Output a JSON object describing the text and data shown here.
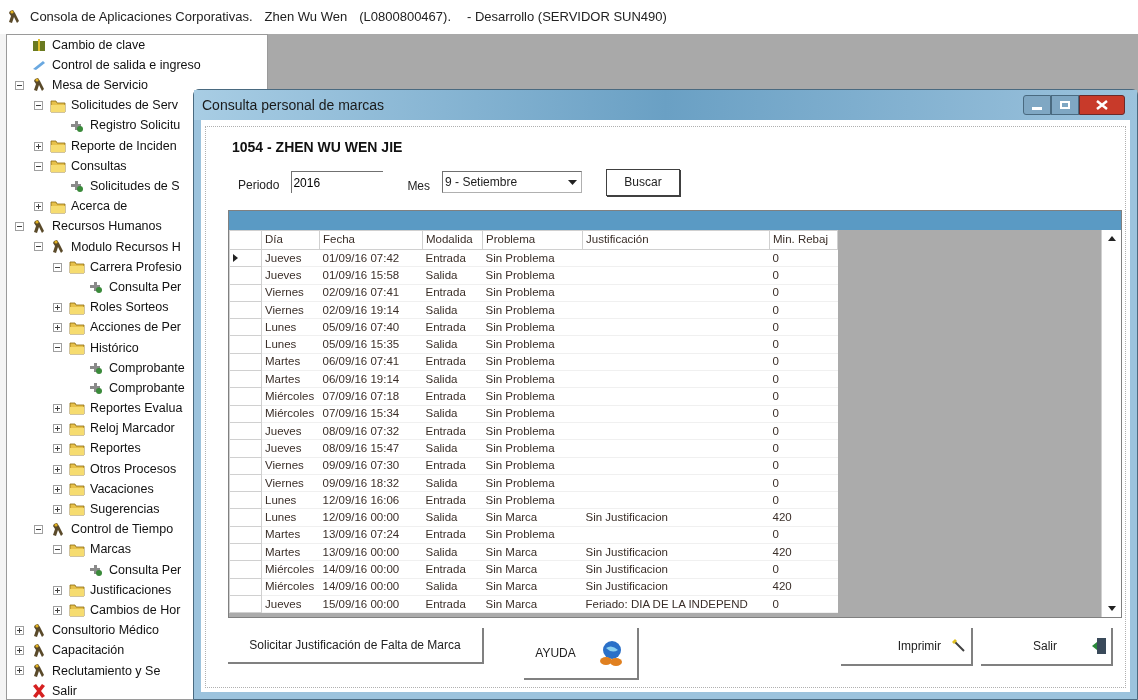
{
  "app_title": {
    "title": "Consola de Aplicaciones Corporativas.",
    "user": "Zhen Wu Wen",
    "code": "(L0800800467).",
    "environment": "- Desarrollo (SERVIDOR SUN490)"
  },
  "tree": [
    {
      "label": "Cambio de clave",
      "kind": "package"
    },
    {
      "label": "Control de salida e ingreso",
      "kind": "pen"
    },
    {
      "label": "Mesa de Servicio",
      "kind": "app",
      "expanded": true,
      "children": [
        {
          "label": "Solicitudes de Serv",
          "kind": "folder",
          "expanded": true,
          "children": [
            {
              "label": "Registro Solicitu",
              "kind": "form"
            }
          ]
        },
        {
          "label": "Reporte de Inciden",
          "kind": "folder",
          "expanded": false
        },
        {
          "label": "Consultas",
          "kind": "folder",
          "expanded": true,
          "children": [
            {
              "label": "Solicitudes de S",
              "kind": "form"
            }
          ]
        },
        {
          "label": "Acerca de",
          "kind": "folder",
          "expanded": false
        }
      ]
    },
    {
      "label": "Recursos Humanos",
      "kind": "app",
      "expanded": true,
      "children": [
        {
          "label": "Modulo Recursos H",
          "kind": "app",
          "expanded": true,
          "children": [
            {
              "label": "Carrera Profesio",
              "kind": "folder",
              "expanded": true,
              "children": [
                {
                  "label": "Consulta Per",
                  "kind": "form"
                }
              ]
            },
            {
              "label": "Roles Sorteos",
              "kind": "folder",
              "expanded": false
            },
            {
              "label": "Acciones de Per",
              "kind": "folder",
              "expanded": false
            },
            {
              "label": "Histórico",
              "kind": "folder",
              "expanded": true,
              "children": [
                {
                  "label": "Comprobante",
                  "kind": "form"
                },
                {
                  "label": "Comprobante",
                  "kind": "form"
                }
              ]
            },
            {
              "label": "Reportes Evalua",
              "kind": "folder",
              "expanded": false
            },
            {
              "label": "Reloj Marcador",
              "kind": "folder",
              "expanded": false
            },
            {
              "label": "Reportes",
              "kind": "folder",
              "expanded": false
            },
            {
              "label": "Otros Procesos",
              "kind": "folder",
              "expanded": false
            },
            {
              "label": "Vacaciones",
              "kind": "folder",
              "expanded": false
            },
            {
              "label": "Sugerencias",
              "kind": "folder",
              "expanded": false
            }
          ]
        },
        {
          "label": "Control de Tiempo",
          "kind": "app",
          "expanded": true,
          "children": [
            {
              "label": "Marcas",
              "kind": "folder",
              "expanded": true,
              "children": [
                {
                  "label": "Consulta Per",
                  "kind": "form"
                }
              ]
            },
            {
              "label": "Justificaciones",
              "kind": "folder",
              "expanded": false
            },
            {
              "label": "Cambios de Hor",
              "kind": "folder",
              "expanded": false
            }
          ]
        }
      ]
    },
    {
      "label": "Consultorio Médico",
      "kind": "app",
      "expanded": false
    },
    {
      "label": "Capacitación",
      "kind": "app",
      "expanded": false
    },
    {
      "label": "Reclutamiento y Se",
      "kind": "app",
      "expanded": false
    },
    {
      "label": "Salir",
      "kind": "exit"
    }
  ],
  "dialog": {
    "title": "Consulta personal de marcas",
    "employee": "1054 - ZHEN WU WEN JIE",
    "period_label": "Periodo",
    "period_value": "2016",
    "month_label": "Mes",
    "month_value": "9 - Setiembre",
    "search_button": "Buscar",
    "table": {
      "columns": [
        "Día",
        "Fecha",
        "Modalida",
        "Problema",
        "Justificación",
        "Min. Rebaj"
      ],
      "rows": [
        {
          "selected": true,
          "cells": [
            "Jueves",
            "01/09/16 07:42",
            "Entrada",
            "Sin Problema",
            "",
            "0"
          ]
        },
        {
          "selected": false,
          "cells": [
            "Jueves",
            "01/09/16 15:58",
            "Salida",
            "Sin Problema",
            "",
            "0"
          ]
        },
        {
          "selected": false,
          "cells": [
            "Viernes",
            "02/09/16 07:41",
            "Entrada",
            "Sin Problema",
            "",
            "0"
          ]
        },
        {
          "selected": false,
          "cells": [
            "Viernes",
            "02/09/16 19:14",
            "Salida",
            "Sin Problema",
            "",
            "0"
          ]
        },
        {
          "selected": false,
          "cells": [
            "Lunes",
            "05/09/16 07:40",
            "Entrada",
            "Sin Problema",
            "",
            "0"
          ]
        },
        {
          "selected": false,
          "cells": [
            "Lunes",
            "05/09/16 15:35",
            "Salida",
            "Sin Problema",
            "",
            "0"
          ]
        },
        {
          "selected": false,
          "cells": [
            "Martes",
            "06/09/16 07:41",
            "Entrada",
            "Sin Problema",
            "",
            "0"
          ]
        },
        {
          "selected": false,
          "cells": [
            "Martes",
            "06/09/16 19:14",
            "Salida",
            "Sin Problema",
            "",
            "0"
          ]
        },
        {
          "selected": false,
          "cells": [
            "Miércoles",
            "07/09/16 07:18",
            "Entrada",
            "Sin Problema",
            "",
            "0"
          ]
        },
        {
          "selected": false,
          "cells": [
            "Miércoles",
            "07/09/16 15:34",
            "Salida",
            "Sin Problema",
            "",
            "0"
          ]
        },
        {
          "selected": false,
          "cells": [
            "Jueves",
            "08/09/16 07:32",
            "Entrada",
            "Sin Problema",
            "",
            "0"
          ]
        },
        {
          "selected": false,
          "cells": [
            "Jueves",
            "08/09/16 15:47",
            "Salida",
            "Sin Problema",
            "",
            "0"
          ]
        },
        {
          "selected": false,
          "cells": [
            "Viernes",
            "09/09/16 07:30",
            "Entrada",
            "Sin Problema",
            "",
            "0"
          ]
        },
        {
          "selected": false,
          "cells": [
            "Viernes",
            "09/09/16 18:32",
            "Salida",
            "Sin Problema",
            "",
            "0"
          ]
        },
        {
          "selected": false,
          "cells": [
            "Lunes",
            "12/09/16 16:06",
            "Entrada",
            "Sin Problema",
            "",
            "0"
          ]
        },
        {
          "selected": false,
          "cells": [
            "Lunes",
            "12/09/16 00:00",
            "Salida",
            "Sin Marca",
            "Sin Justificacion",
            "420"
          ]
        },
        {
          "selected": false,
          "cells": [
            "Martes",
            "13/09/16 07:24",
            "Entrada",
            "Sin Problema",
            "",
            "0"
          ]
        },
        {
          "selected": false,
          "cells": [
            "Martes",
            "13/09/16 00:00",
            "Salida",
            "Sin Marca",
            "Sin Justificacion",
            "420"
          ]
        },
        {
          "selected": false,
          "cells": [
            "Miércoles",
            "14/09/16 00:00",
            "Entrada",
            "Sin Marca",
            "Sin Justificacion",
            "0"
          ]
        },
        {
          "selected": false,
          "cells": [
            "Miércoles",
            "14/09/16 00:00",
            "Salida",
            "Sin Marca",
            "Sin Justificacion",
            "420"
          ]
        },
        {
          "selected": false,
          "cells": [
            "Jueves",
            "15/09/16 00:00",
            "Entrada",
            "Sin Marca",
            "Feriado: DIA DE LA INDEPEND",
            "0"
          ]
        }
      ]
    },
    "buttons": [
      {
        "label": "Solicitar Justificación de Falta de Marca",
        "kind": "plain"
      },
      {
        "label": "AYUDA",
        "kind": "help"
      },
      {
        "label": "Imprimir",
        "kind": "print"
      },
      {
        "label": "Salir",
        "kind": "exit"
      }
    ]
  }
}
